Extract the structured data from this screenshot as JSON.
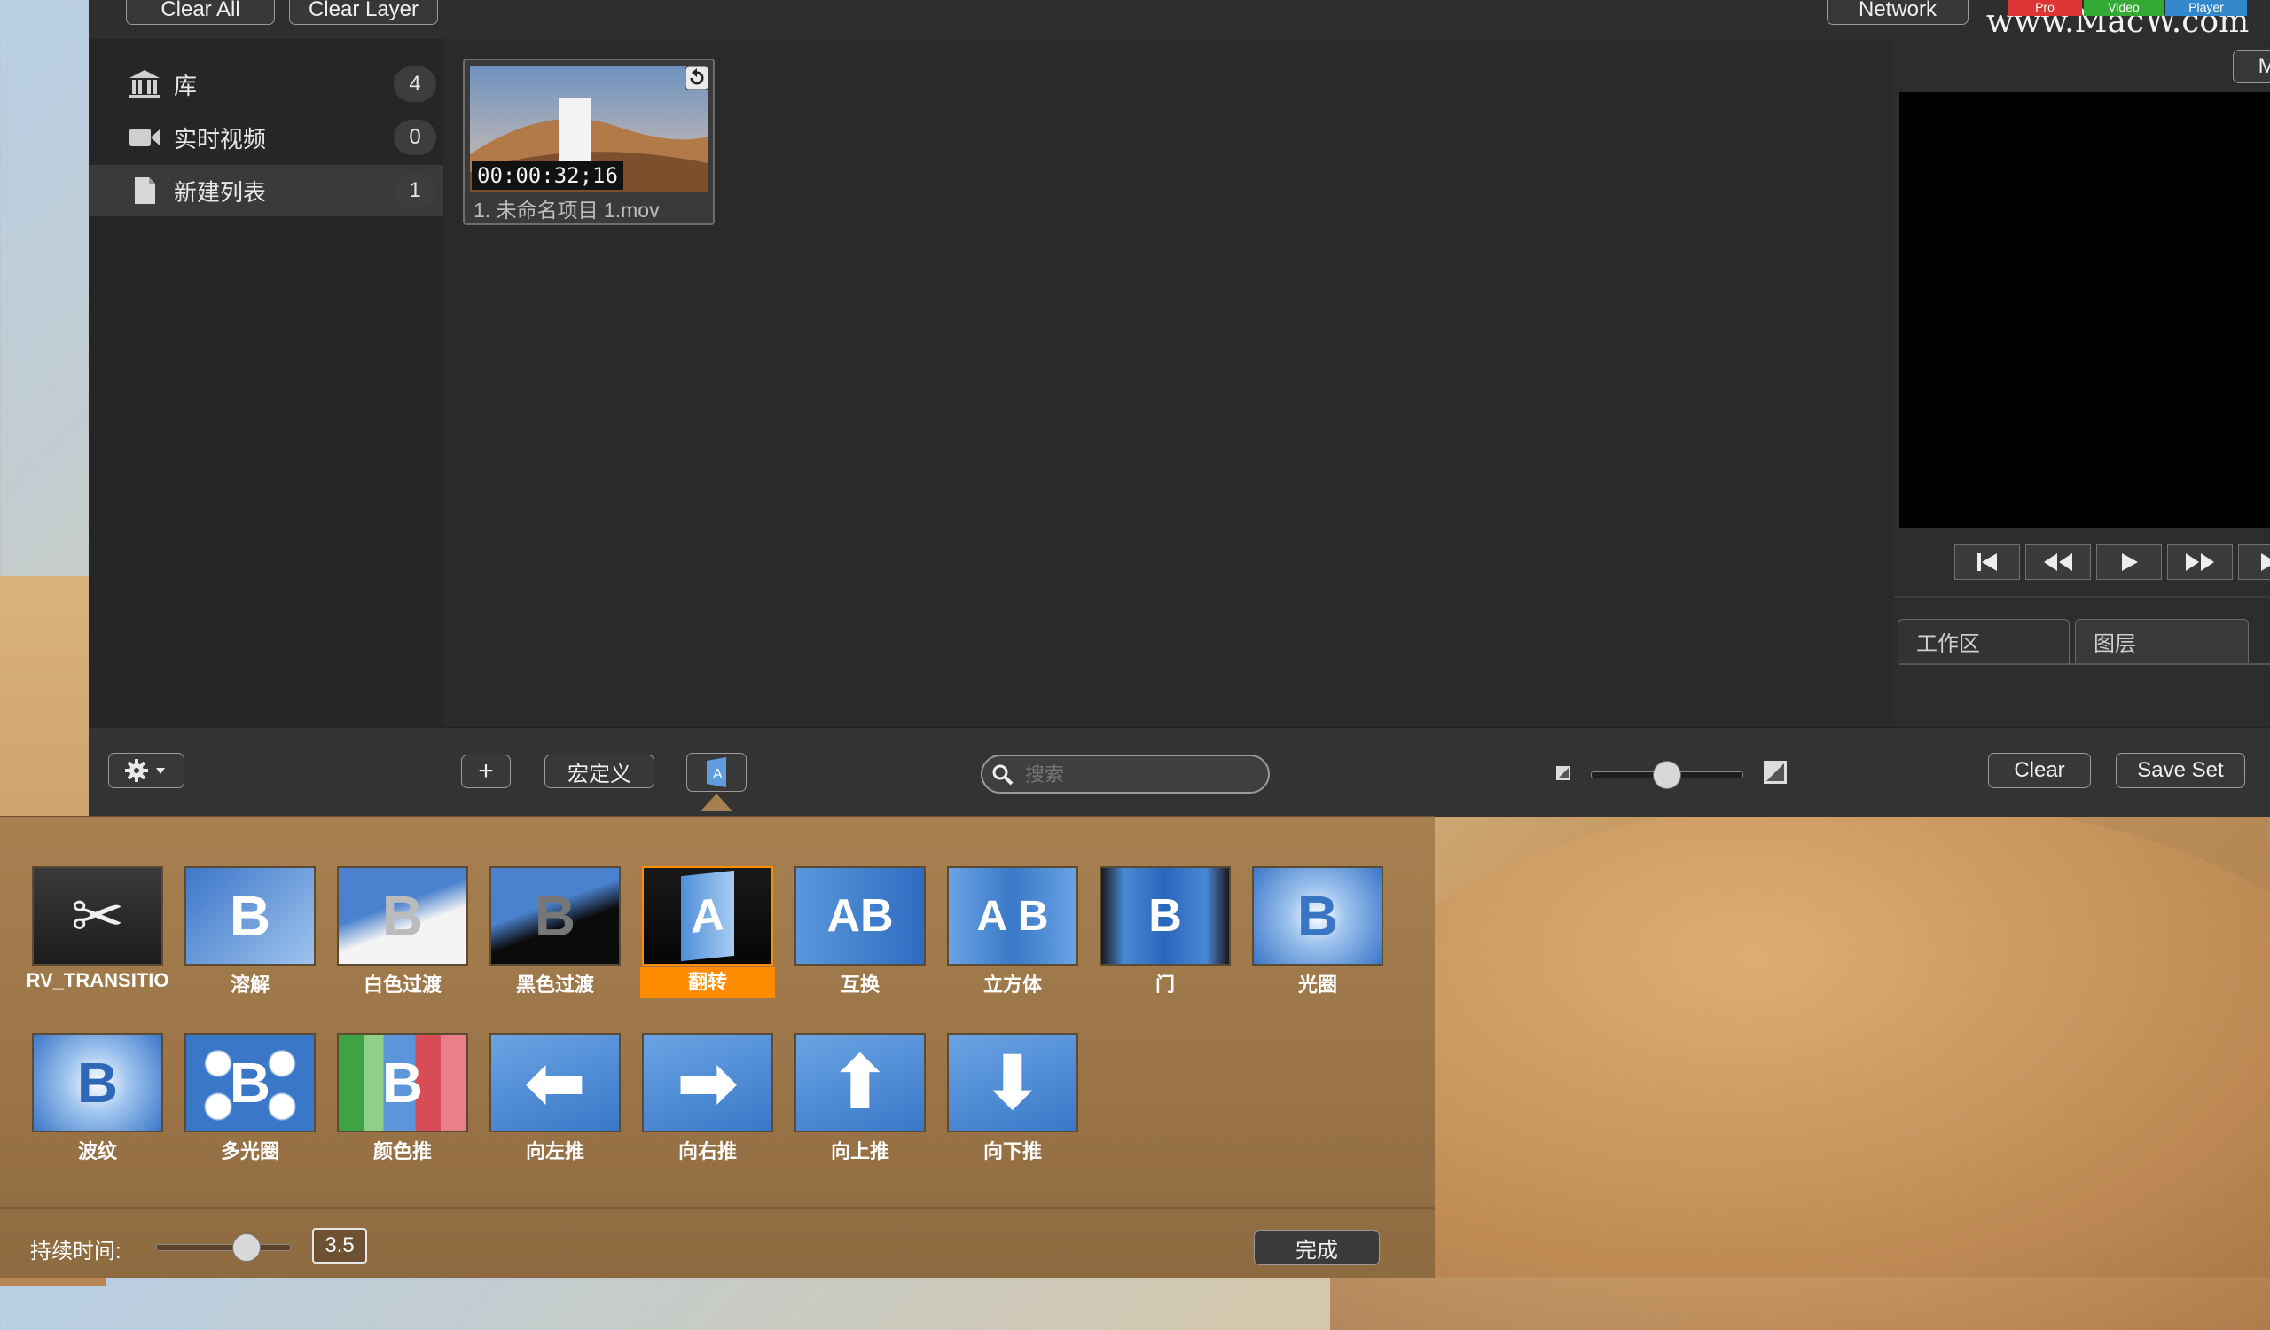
{
  "topbar": {
    "clear_all": "Clear All",
    "clear_layer": "Clear Layer",
    "network": "Network"
  },
  "watermark": {
    "text": "www.MacW.com",
    "tags": [
      "Pro",
      "Video",
      "Player"
    ]
  },
  "sidebar": {
    "items": [
      {
        "label": "库",
        "count": "4"
      },
      {
        "label": "实时视频",
        "count": "0"
      },
      {
        "label": "新建列表",
        "count": "1"
      }
    ]
  },
  "media": {
    "timecode": "00:00:32;16",
    "name": "1. 未命名项目 1.mov"
  },
  "preview": {
    "manual": "Manual"
  },
  "tabs": [
    {
      "label": "工作区"
    },
    {
      "label": "图层"
    }
  ],
  "toolbar": {
    "macro": "宏定义",
    "search_placeholder": "搜索",
    "clear": "Clear",
    "save_set": "Save Set"
  },
  "transitions": [
    {
      "label": "RV_TRANSITIO",
      "glyph": "✂"
    },
    {
      "label": "溶解",
      "glyph": "B"
    },
    {
      "label": "白色过渡",
      "glyph": "B"
    },
    {
      "label": "黑色过渡",
      "glyph": "B"
    },
    {
      "label": "翻转",
      "glyph": "A"
    },
    {
      "label": "互换",
      "glyph": "AB"
    },
    {
      "label": "立方体",
      "glyph": "A B"
    },
    {
      "label": "门",
      "glyph": "B"
    },
    {
      "label": "光圈",
      "glyph": "B"
    },
    {
      "label": "波纹",
      "glyph": "B"
    },
    {
      "label": "多光圈",
      "glyph": "B"
    },
    {
      "label": "颜色推",
      "glyph": "B"
    },
    {
      "label": "向左推",
      "glyph": "⬅"
    },
    {
      "label": "向右推",
      "glyph": "➡"
    },
    {
      "label": "向上推",
      "glyph": "⬆"
    },
    {
      "label": "向下推",
      "glyph": "⬇"
    }
  ],
  "duration": {
    "label": "持续时间:",
    "value": "3.5",
    "done": "完成"
  },
  "colors": {
    "accent": "#ff8c00",
    "tile_blue": "#3f7fd0"
  }
}
